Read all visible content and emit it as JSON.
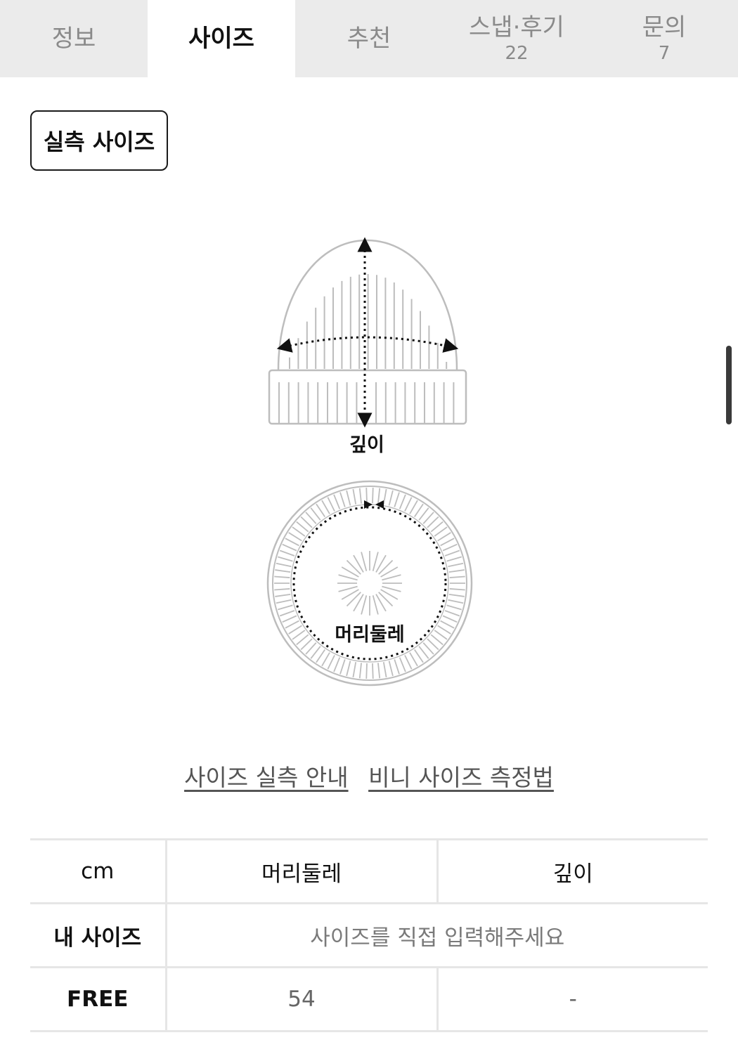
{
  "tabs": [
    {
      "label": "정보",
      "count": ""
    },
    {
      "label": "사이즈",
      "count": "",
      "active": true
    },
    {
      "label": "추천",
      "count": ""
    },
    {
      "label": "스냅·후기",
      "count": "22"
    },
    {
      "label": "문의",
      "count": "7"
    }
  ],
  "section_button": "실측 사이즈",
  "illustration": {
    "depth_label": "깊이",
    "head_label": "머리둘레"
  },
  "links": {
    "guide": "사이즈 실측 안내",
    "beanie_measure": "비니 사이즈 측정법"
  },
  "table": {
    "headers": [
      "cm",
      "머리둘레",
      "깊이"
    ],
    "my_size": {
      "label": "내 사이즈",
      "placeholder": "사이즈를 직접 입력해주세요"
    },
    "rows": [
      {
        "size": "FREE",
        "head": "54",
        "depth": "-"
      }
    ]
  }
}
